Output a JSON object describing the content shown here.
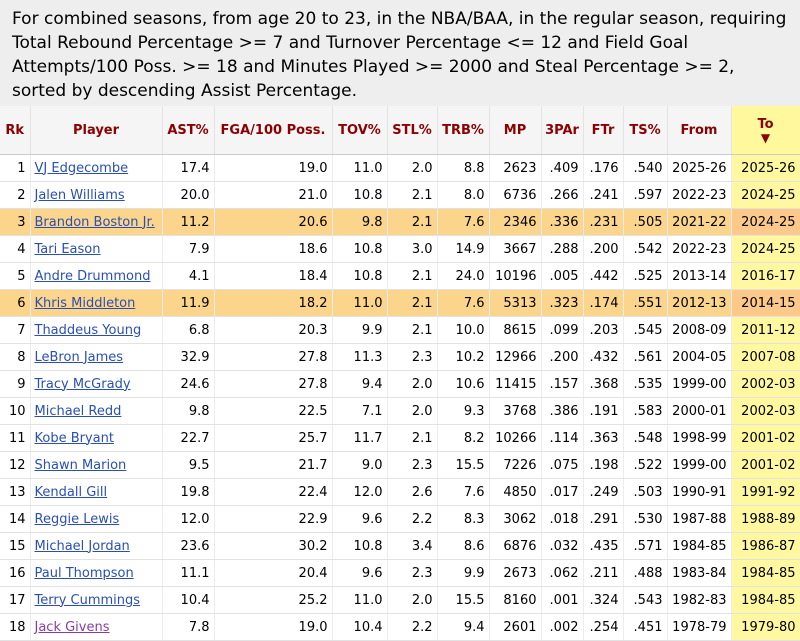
{
  "summary": "For combined seasons, from age 20 to 23, in the NBA/BAA, in the regular season, requiring Total Rebound Percentage >= 7 and Turnover Percentage <= 12 and Field Goal Attempts/100 Poss. >= 18 and Minutes Played >= 2000 and Steal Percentage >= 2, sorted by descending Assist Percentage.",
  "headers": [
    "Rk",
    "Player",
    "AST%",
    "FGA/100 Poss.",
    "TOV%",
    "STL%",
    "TRB%",
    "MP",
    "3PAr",
    "FTr",
    "TS%",
    "From",
    "To"
  ],
  "sort_arrow": "▼",
  "rows": [
    {
      "rk": "1",
      "player": "VJ Edgecombe",
      "ast": "17.4",
      "fga": "19.0",
      "tov": "11.0",
      "stl": "2.0",
      "trb": "8.8",
      "mp": "2623",
      "tpar": ".409",
      "ftr": ".176",
      "ts": ".540",
      "from": "2025-26",
      "to": "2025-26",
      "hl": false
    },
    {
      "rk": "2",
      "player": "Jalen Williams",
      "ast": "20.0",
      "fga": "21.0",
      "tov": "10.8",
      "stl": "2.1",
      "trb": "8.0",
      "mp": "6736",
      "tpar": ".266",
      "ftr": ".241",
      "ts": ".597",
      "from": "2022-23",
      "to": "2024-25",
      "hl": false
    },
    {
      "rk": "3",
      "player": "Brandon Boston Jr.",
      "ast": "11.2",
      "fga": "20.6",
      "tov": "9.8",
      "stl": "2.1",
      "trb": "7.6",
      "mp": "2346",
      "tpar": ".336",
      "ftr": ".231",
      "ts": ".505",
      "from": "2021-22",
      "to": "2024-25",
      "hl": true
    },
    {
      "rk": "4",
      "player": "Tari Eason",
      "ast": "7.9",
      "fga": "18.6",
      "tov": "10.8",
      "stl": "3.0",
      "trb": "14.9",
      "mp": "3667",
      "tpar": ".288",
      "ftr": ".200",
      "ts": ".542",
      "from": "2022-23",
      "to": "2024-25",
      "hl": false
    },
    {
      "rk": "5",
      "player": "Andre Drummond",
      "ast": "4.1",
      "fga": "18.4",
      "tov": "10.8",
      "stl": "2.1",
      "trb": "24.0",
      "mp": "10196",
      "tpar": ".005",
      "ftr": ".442",
      "ts": ".525",
      "from": "2013-14",
      "to": "2016-17",
      "hl": false
    },
    {
      "rk": "6",
      "player": "Khris Middleton",
      "ast": "11.9",
      "fga": "18.2",
      "tov": "11.0",
      "stl": "2.1",
      "trb": "7.6",
      "mp": "5313",
      "tpar": ".323",
      "ftr": ".174",
      "ts": ".551",
      "from": "2012-13",
      "to": "2014-15",
      "hl": true
    },
    {
      "rk": "7",
      "player": "Thaddeus Young",
      "ast": "6.8",
      "fga": "20.3",
      "tov": "9.9",
      "stl": "2.1",
      "trb": "10.0",
      "mp": "8615",
      "tpar": ".099",
      "ftr": ".203",
      "ts": ".545",
      "from": "2008-09",
      "to": "2011-12",
      "hl": false
    },
    {
      "rk": "8",
      "player": "LeBron James",
      "ast": "32.9",
      "fga": "27.8",
      "tov": "11.3",
      "stl": "2.3",
      "trb": "10.2",
      "mp": "12966",
      "tpar": ".200",
      "ftr": ".432",
      "ts": ".561",
      "from": "2004-05",
      "to": "2007-08",
      "hl": false
    },
    {
      "rk": "9",
      "player": "Tracy McGrady",
      "ast": "24.6",
      "fga": "27.8",
      "tov": "9.4",
      "stl": "2.0",
      "trb": "10.6",
      "mp": "11415",
      "tpar": ".157",
      "ftr": ".368",
      "ts": ".535",
      "from": "1999-00",
      "to": "2002-03",
      "hl": false
    },
    {
      "rk": "10",
      "player": "Michael Redd",
      "ast": "9.8",
      "fga": "22.5",
      "tov": "7.1",
      "stl": "2.0",
      "trb": "9.3",
      "mp": "3768",
      "tpar": ".386",
      "ftr": ".191",
      "ts": ".583",
      "from": "2000-01",
      "to": "2002-03",
      "hl": false
    },
    {
      "rk": "11",
      "player": "Kobe Bryant",
      "ast": "22.7",
      "fga": "25.7",
      "tov": "11.7",
      "stl": "2.1",
      "trb": "8.2",
      "mp": "10266",
      "tpar": ".114",
      "ftr": ".363",
      "ts": ".548",
      "from": "1998-99",
      "to": "2001-02",
      "hl": false
    },
    {
      "rk": "12",
      "player": "Shawn Marion",
      "ast": "9.5",
      "fga": "21.7",
      "tov": "9.0",
      "stl": "2.3",
      "trb": "15.5",
      "mp": "7226",
      "tpar": ".075",
      "ftr": ".198",
      "ts": ".522",
      "from": "1999-00",
      "to": "2001-02",
      "hl": false
    },
    {
      "rk": "13",
      "player": "Kendall Gill",
      "ast": "19.8",
      "fga": "22.4",
      "tov": "12.0",
      "stl": "2.6",
      "trb": "7.6",
      "mp": "4850",
      "tpar": ".017",
      "ftr": ".249",
      "ts": ".503",
      "from": "1990-91",
      "to": "1991-92",
      "hl": false
    },
    {
      "rk": "14",
      "player": "Reggie Lewis",
      "ast": "12.0",
      "fga": "22.9",
      "tov": "9.6",
      "stl": "2.2",
      "trb": "8.3",
      "mp": "3062",
      "tpar": ".018",
      "ftr": ".291",
      "ts": ".530",
      "from": "1987-88",
      "to": "1988-89",
      "hl": false
    },
    {
      "rk": "15",
      "player": "Michael Jordan",
      "ast": "23.6",
      "fga": "30.2",
      "tov": "10.8",
      "stl": "3.4",
      "trb": "8.6",
      "mp": "6876",
      "tpar": ".032",
      "ftr": ".435",
      "ts": ".571",
      "from": "1984-85",
      "to": "1986-87",
      "hl": false
    },
    {
      "rk": "16",
      "player": "Paul Thompson",
      "ast": "11.1",
      "fga": "20.4",
      "tov": "9.6",
      "stl": "2.3",
      "trb": "9.9",
      "mp": "2673",
      "tpar": ".062",
      "ftr": ".211",
      "ts": ".488",
      "from": "1983-84",
      "to": "1984-85",
      "hl": false
    },
    {
      "rk": "17",
      "player": "Terry Cummings",
      "ast": "10.4",
      "fga": "25.2",
      "tov": "11.0",
      "stl": "2.0",
      "trb": "15.5",
      "mp": "8160",
      "tpar": ".001",
      "ftr": ".324",
      "ts": ".543",
      "from": "1982-83",
      "to": "1984-85",
      "hl": false
    },
    {
      "rk": "18",
      "player": "Jack Givens",
      "ast": "7.8",
      "fga": "19.0",
      "tov": "10.4",
      "stl": "2.2",
      "trb": "9.4",
      "mp": "2601",
      "tpar": ".002",
      "ftr": ".254",
      "ts": ".451",
      "from": "1978-79",
      "to": "1979-80",
      "hl": false,
      "visited": true
    }
  ]
}
